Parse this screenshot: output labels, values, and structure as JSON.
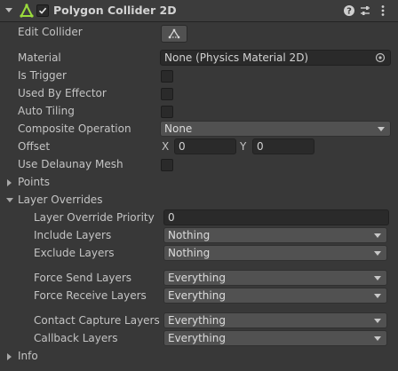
{
  "component": {
    "title": "Polygon Collider 2D",
    "enabled": true,
    "icons": [
      "chevron-down-icon",
      "polygon-collider-icon",
      "help-icon",
      "presets-icon",
      "more-vertical-icon"
    ]
  },
  "fields": {
    "edit_collider": "Edit Collider",
    "material": {
      "label": "Material",
      "value": "None (Physics Material 2D)"
    },
    "is_trigger": "Is Trigger",
    "used_by_effector": "Used By Effector",
    "auto_tiling": "Auto Tiling",
    "composite_operation": {
      "label": "Composite Operation",
      "value": "None"
    },
    "offset": {
      "label": "Offset",
      "x_label": "X",
      "x": "0",
      "y_label": "Y",
      "y": "0"
    },
    "use_delaunay_mesh": "Use Delaunay Mesh",
    "points": "Points",
    "layer_overrides": {
      "label": "Layer Overrides",
      "priority": {
        "label": "Layer Override Priority",
        "value": "0"
      },
      "include": {
        "label": "Include Layers",
        "value": "Nothing"
      },
      "exclude": {
        "label": "Exclude Layers",
        "value": "Nothing"
      },
      "force_send": {
        "label": "Force Send Layers",
        "value": "Everything"
      },
      "force_receive": {
        "label": "Force Receive Layers",
        "value": "Everything"
      },
      "contact_capture": {
        "label": "Contact Capture Layers",
        "value": "Everything"
      },
      "callback": {
        "label": "Callback Layers",
        "value": "Everything"
      }
    },
    "info": "Info"
  },
  "colors": {
    "background": "#383838",
    "field": "#2a2a2a",
    "dropdown": "#515151",
    "icon_green": "#9bdc3c"
  }
}
